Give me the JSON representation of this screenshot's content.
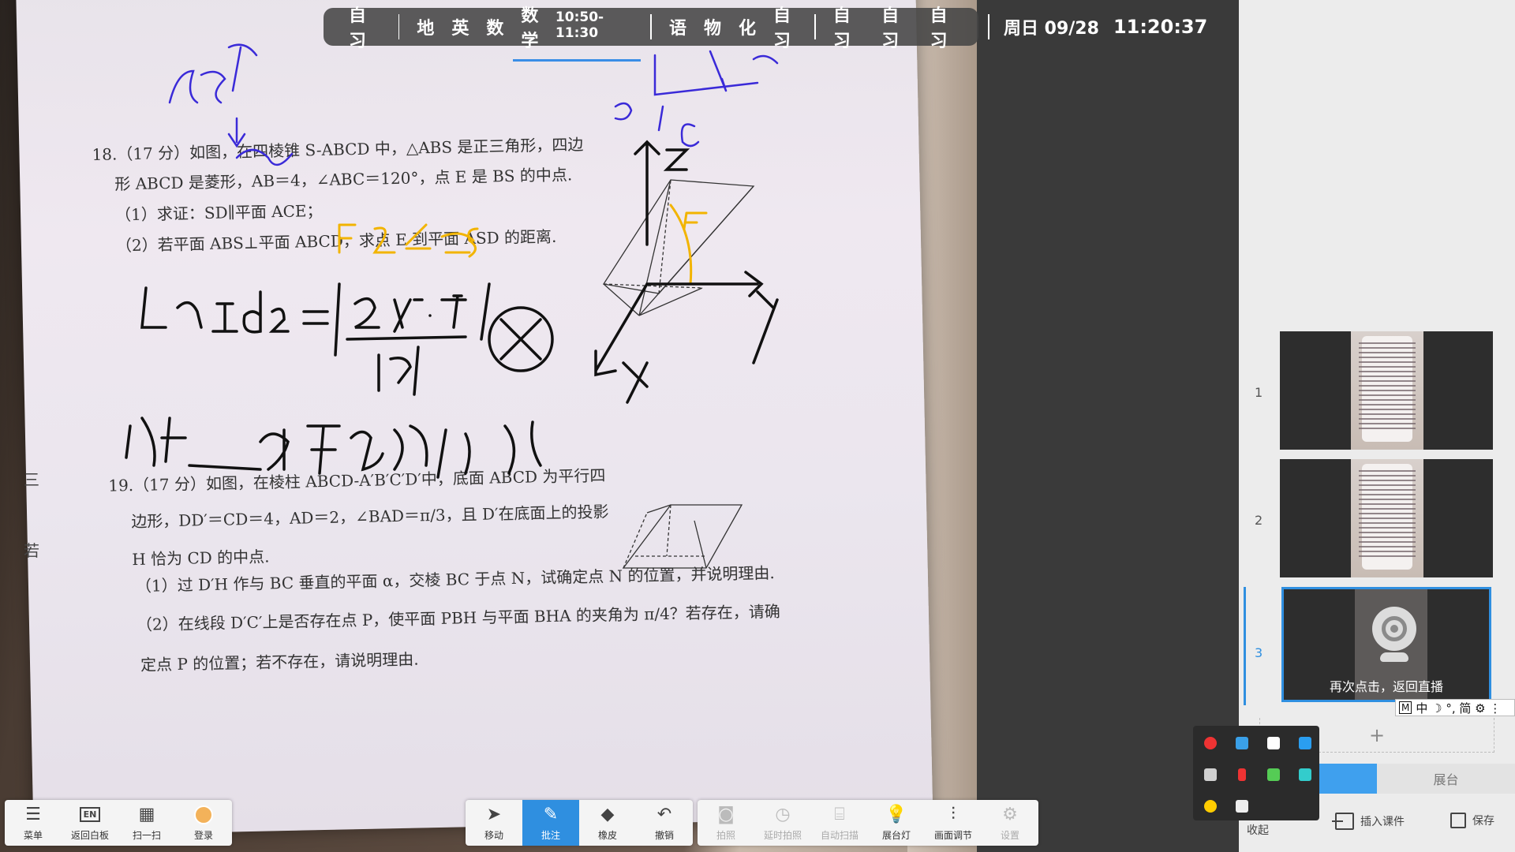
{
  "schedule": {
    "before": [
      "自习"
    ],
    "group1": [
      "地",
      "英",
      "数"
    ],
    "current_subject": "数学",
    "current_time": "10:50-11:30",
    "group2": [
      "语",
      "物",
      "化",
      "自习"
    ],
    "group3": [
      "自习",
      "自习",
      "自习"
    ]
  },
  "clock": {
    "date": "周日 09/28",
    "time": "11:20:37"
  },
  "document": {
    "p18": {
      "line1": "18.（17 分）如图，在四棱锥 S-ABCD 中，△ABS 是正三角形，四边",
      "line2": "形 ABCD 是菱形，AB＝4，∠ABC＝120°，点 E 是 BS 的中点.",
      "line3": "（1）求证：SD∥平面 ACE；",
      "line4": "（2）若平面 ABS⊥平面 ABCD，求点 E 到平面 ASD 的距离."
    },
    "p19": {
      "line1": "19.（17 分）如图，在棱柱 ABCD-A′B′C′D′中，底面 ABCD 为平行四",
      "line2": "边形，DD′＝CD＝4，AD＝2，∠BAD＝π/3，且 D′在底面上的投影",
      "line3": "H 恰为 CD 的中点.",
      "line4": "（1）过 D′H 作与 BC 垂直的平面 α，交棱 BC 于点 N，试确定点 N 的位置，并说明理由.",
      "line5": "（2）在线段 D′C′上是否存在点 P，使平面 PBH 与平面 BHA 的夹角为 π/4？若存在，请确",
      "line6": "定点 P 的位置；若不存在，请说明理由."
    },
    "margin_chars": [
      "三",
      "若"
    ]
  },
  "pages": [
    {
      "num": "1"
    },
    {
      "num": "2"
    },
    {
      "num": "3",
      "overlay_text": "再次点击，返回直播"
    }
  ],
  "ime": {
    "m": "M",
    "chars": "中 ☽ °, 简 ⚙ ⋮"
  },
  "add_page": "+",
  "mode_tabs": {
    "left": "",
    "right": "展台"
  },
  "bottom_right": {
    "collapse": "收起",
    "insert": "插入课件",
    "save": "保存"
  },
  "left_toolbar": [
    {
      "label": "菜单",
      "icon": "menu-icon"
    },
    {
      "label": "返回白板",
      "icon": "whiteboard-icon"
    },
    {
      "label": "扫一扫",
      "icon": "qr-icon"
    },
    {
      "label": "登录",
      "icon": "avatar-icon"
    }
  ],
  "center_toolbar": [
    {
      "label": "移动",
      "icon": "cursor-icon"
    },
    {
      "label": "批注",
      "icon": "pen-icon"
    },
    {
      "label": "橡皮",
      "icon": "eraser-icon"
    },
    {
      "label": "撤销",
      "icon": "undo-icon"
    }
  ],
  "right_toolbar": [
    {
      "label": "拍照",
      "icon": "camera-icon"
    },
    {
      "label": "延时拍照",
      "icon": "timer-icon"
    },
    {
      "label": "自动扫描",
      "icon": "scan-icon"
    },
    {
      "label": "展台灯",
      "icon": "bulb-icon"
    },
    {
      "label": "画面调节",
      "icon": "sliders-icon"
    },
    {
      "label": "设置",
      "icon": "gear-icon"
    }
  ],
  "colors": {
    "accent": "#2f8fe0",
    "bar": "#464646",
    "panel": "#ececec"
  }
}
